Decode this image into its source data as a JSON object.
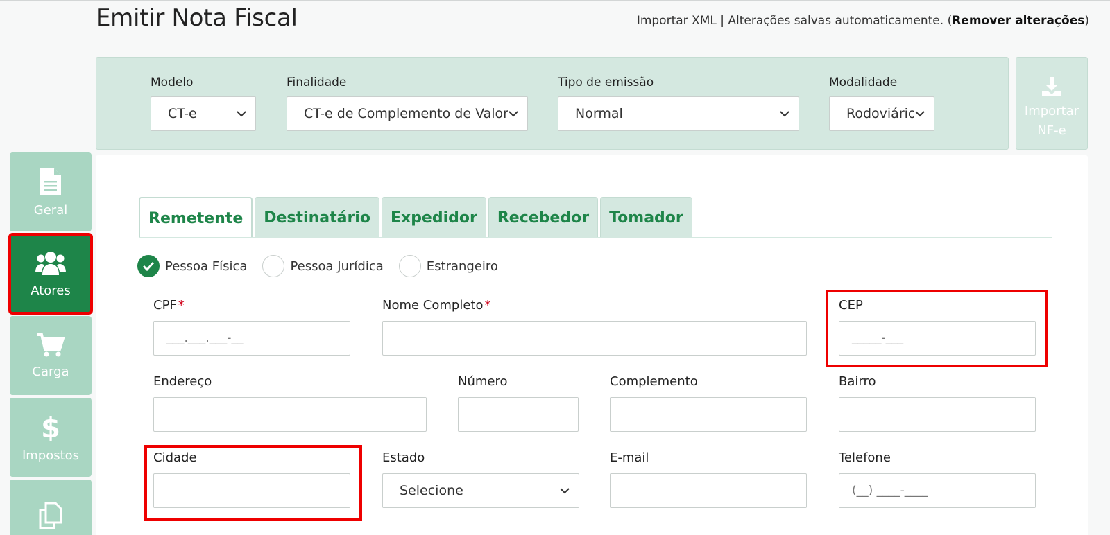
{
  "page": {
    "title": "Emitir Nota Fiscal",
    "import_xml": "Importar XML",
    "saved_text": " | Alterações salvas automaticamente. (",
    "remove_changes": "Remover alterações",
    "close_paren": ")"
  },
  "config": {
    "modelo": {
      "label": "Modelo",
      "value": "CT-e"
    },
    "finalidade": {
      "label": "Finalidade",
      "value": "CT-e de Complemento de Valor"
    },
    "tipo_emissao": {
      "label": "Tipo de emissão",
      "value": "Normal"
    },
    "modalidade": {
      "label": "Modalidade",
      "value": "Rodoviário"
    },
    "import_nfe_line1": "Importar",
    "import_nfe_line2": "NF-e"
  },
  "sidebar": {
    "items": [
      {
        "label": "Geral",
        "icon": "document-icon"
      },
      {
        "label": "Atores",
        "icon": "users-icon",
        "active": true
      },
      {
        "label": "Carga",
        "icon": "cart-icon"
      },
      {
        "label": "Impostos",
        "icon": "dollar-icon"
      },
      {
        "label": "",
        "icon": "copy-icon"
      }
    ]
  },
  "tabs": [
    "Remetente",
    "Destinatário",
    "Expedidor",
    "Recebedor",
    "Tomador"
  ],
  "person_types": [
    "Pessoa Física",
    "Pessoa Jurídica",
    "Estrangeiro"
  ],
  "form": {
    "cpf": {
      "label": "CPF",
      "placeholder": "___.___.___-__"
    },
    "nome": {
      "label": "Nome Completo",
      "value": ""
    },
    "cep": {
      "label": "CEP",
      "placeholder": "_____-___"
    },
    "endereco": {
      "label": "Endereço",
      "value": ""
    },
    "numero": {
      "label": "Número",
      "value": ""
    },
    "complemento": {
      "label": "Complemento",
      "value": ""
    },
    "bairro": {
      "label": "Bairro",
      "value": ""
    },
    "cidade": {
      "label": "Cidade",
      "value": ""
    },
    "estado": {
      "label": "Estado",
      "value": "Selecione"
    },
    "email": {
      "label": "E-mail",
      "value": ""
    },
    "telefone": {
      "label": "Telefone",
      "placeholder": "(__) ____-____"
    }
  },
  "colors": {
    "accent": "#1e8549",
    "panel": "#d4e8e0",
    "highlight": "#ee0000"
  }
}
